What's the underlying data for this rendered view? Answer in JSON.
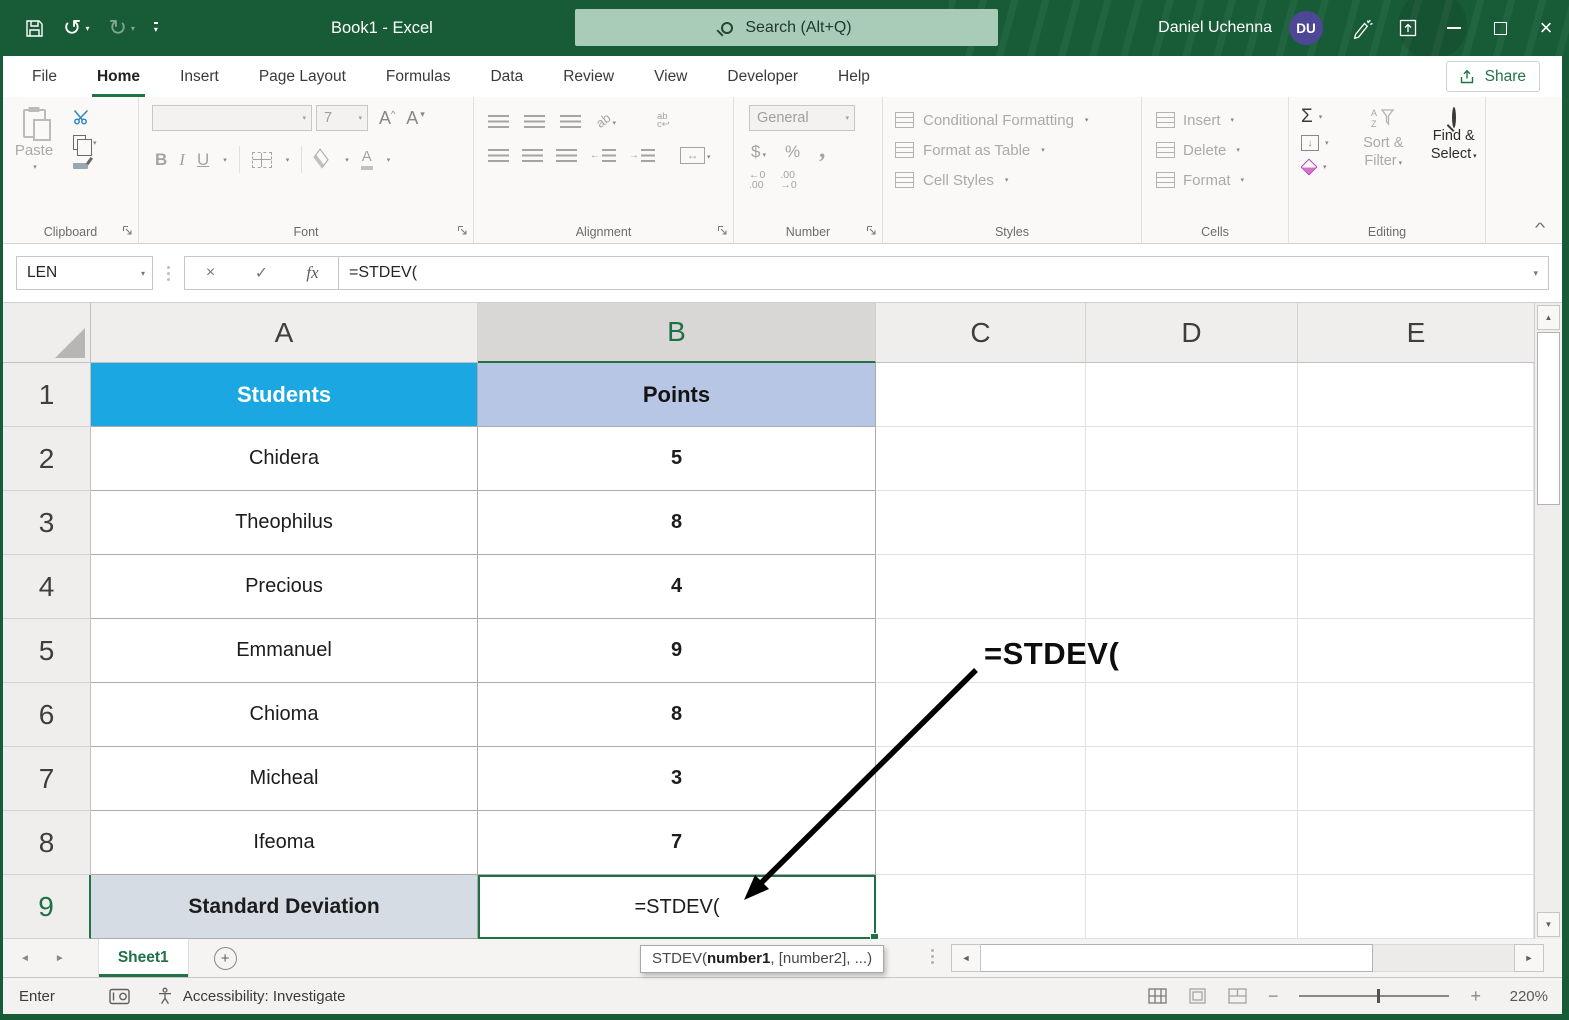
{
  "colors": {
    "accent_green": "#217346",
    "titlebar_green": "#185C37",
    "cell_a1_fill": "#1BA8E2",
    "cell_b1_fill": "#B6C6E4",
    "cell_a9_fill": "#D6DCE4",
    "avatar_purple": "#4D4796",
    "search_fill": "#A9CCB9"
  },
  "icons": {
    "undo": "↺",
    "redo": "↻",
    "chevron_down": "▾",
    "dropdown": "▾",
    "close": "×",
    "cancel": "×",
    "check": "✓",
    "fx": "fx",
    "sigma": "Σ",
    "bold": "B",
    "italic": "I",
    "underline": "U",
    "dollar": "$",
    "percent": "%",
    "comma": ",",
    "dec_inc_top": "←0",
    "dec_inc_bot": ".00",
    "dec_dec_top": ".00",
    "dec_dec_bot": "→0",
    "left_tri": "◄",
    "right_tri": "►",
    "up_tri": "▲",
    "down_tri": "▼",
    "plus": "+",
    "minus": "−",
    "caret_up": "^",
    "collapse": "^",
    "letter_A": "A",
    "orient_ab": "ab",
    "wrap_top": "ab",
    "wrap_bot": "c↩",
    "merge_arrows": "↔",
    "fill_down_arrow": "↓",
    "indent_left_arrow": "←",
    "indent_right_arrow": "→"
  },
  "titlebar": {
    "title": "Book1  -  Excel",
    "search_placeholder": "Search (Alt+Q)",
    "user_name": "Daniel Uchenna",
    "user_initials": "DU"
  },
  "ribbon": {
    "tabs": [
      "File",
      "Home",
      "Insert",
      "Page Layout",
      "Formulas",
      "Data",
      "Review",
      "View",
      "Developer",
      "Help"
    ],
    "active_tab": "Home",
    "share_label": "Share",
    "paste_label": "Paste",
    "font_size_value": "7",
    "number_format_value": "General",
    "group_labels": [
      "Clipboard",
      "Font",
      "Alignment",
      "Number",
      "Styles",
      "Cells",
      "Editing"
    ],
    "styles_items": [
      "Conditional Formatting",
      "Format as Table",
      "Cell Styles"
    ],
    "cells_items": [
      "Insert",
      "Delete",
      "Format"
    ],
    "sort_filter_line1": "Sort &",
    "sort_filter_line2": "Filter",
    "find_select_line1": "Find &",
    "find_select_line2": "Select"
  },
  "formula_bar": {
    "name_box_value": "LEN",
    "formula_value": "=STDEV("
  },
  "sheet": {
    "col_headers": [
      "A",
      "B",
      "C",
      "D",
      "E"
    ],
    "header_row": {
      "num": "1",
      "a": "Students",
      "b": "Points"
    },
    "rows": [
      {
        "num": "2",
        "name": "Chidera",
        "points": "5"
      },
      {
        "num": "3",
        "name": "Theophilus",
        "points": "8"
      },
      {
        "num": "4",
        "name": "Precious",
        "points": "4"
      },
      {
        "num": "5",
        "name": "Emmanuel",
        "points": "9"
      },
      {
        "num": "6",
        "name": "Chioma",
        "points": "8"
      },
      {
        "num": "7",
        "name": "Micheal",
        "points": "3"
      },
      {
        "num": "8",
        "name": "Ifeoma",
        "points": "7"
      }
    ],
    "total_row": {
      "num": "9",
      "label": "Standard Deviation",
      "value": "=STDEV("
    },
    "annotation": "=STDEV(",
    "tooltip": {
      "pre": "STDEV(",
      "bold": "number1",
      "post": ", [number2], ...)"
    }
  },
  "sheet_bar": {
    "active_tab": "Sheet1"
  },
  "status_bar": {
    "mode": "Enter",
    "accessibility": "Accessibility: Investigate",
    "zoom": "220%"
  }
}
